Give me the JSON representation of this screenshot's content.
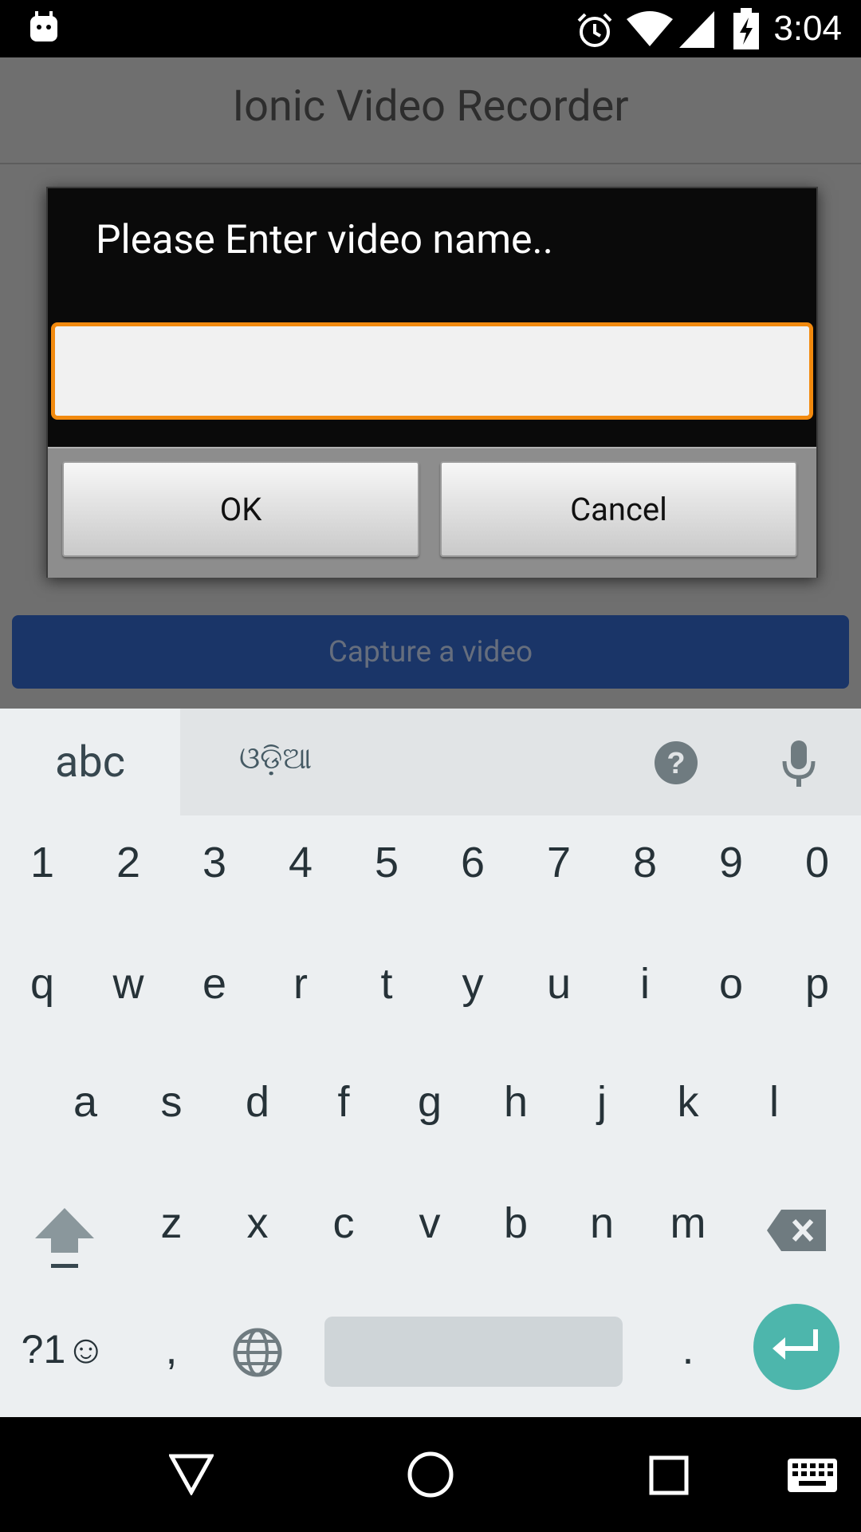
{
  "status_bar": {
    "time": "3:04",
    "icons": [
      "android-debug-icon",
      "alarm-icon",
      "wifi-icon",
      "signal-icon",
      "battery-charging-icon"
    ]
  },
  "app": {
    "title": "Ionic Video Recorder",
    "capture_button_label": "Capture a video"
  },
  "dialog": {
    "title": "Please Enter video name..",
    "input_value": "",
    "ok_label": "OK",
    "cancel_label": "Cancel",
    "accent_color": "#f28a0f"
  },
  "keyboard": {
    "tabs": {
      "abc": "abc",
      "lang": "ଓଡ଼ିଆ"
    },
    "number_row": [
      "1",
      "2",
      "3",
      "4",
      "5",
      "6",
      "7",
      "8",
      "9",
      "0"
    ],
    "row_q": [
      "q",
      "w",
      "e",
      "r",
      "t",
      "y",
      "u",
      "i",
      "o",
      "p"
    ],
    "row_a": [
      "a",
      "s",
      "d",
      "f",
      "g",
      "h",
      "j",
      "k",
      "l"
    ],
    "row_z": [
      "z",
      "x",
      "c",
      "v",
      "b",
      "n",
      "m"
    ],
    "symbols_label": "?1☺",
    "comma": ",",
    "period": ".",
    "enter_color": "#4db6ac"
  },
  "nav_bar": {
    "buttons": [
      "back-icon",
      "home-icon",
      "recents-icon",
      "keyboard-switch-icon"
    ]
  }
}
